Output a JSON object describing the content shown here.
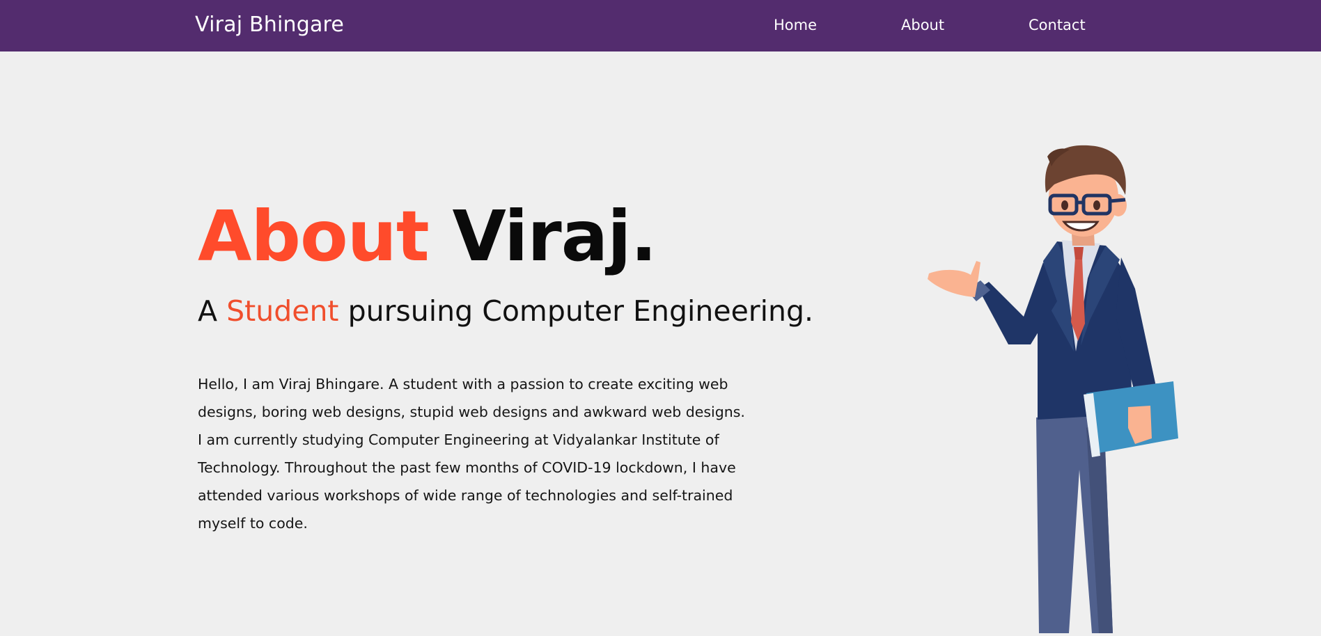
{
  "navbar": {
    "brand": "Viraj Bhingare",
    "links": [
      "Home",
      "About",
      "Contact"
    ]
  },
  "hero": {
    "title_accent": "About",
    "title_name": "Viraj.",
    "subtitle_prefix": "A",
    "subtitle_accent": "Student",
    "subtitle_rest": "pursuing Computer Engineering.",
    "bio": "Hello, I am Viraj Bhingare. A student with a passion to create exciting web designs, boring web designs, stupid web designs and awkward web designs. I am currently studying Computer Engineering at Vidyalankar Institute of Technology. Throughout the past few months of COVID-19 lockdown, I have attended various workshops of wide range of technologies and self-trained myself to code."
  },
  "colors": {
    "navbar": "#532c6e",
    "accent": "#ff4b2b",
    "background": "#efefef"
  },
  "illustration": {
    "icon": "businessman-presenting-illustration"
  }
}
